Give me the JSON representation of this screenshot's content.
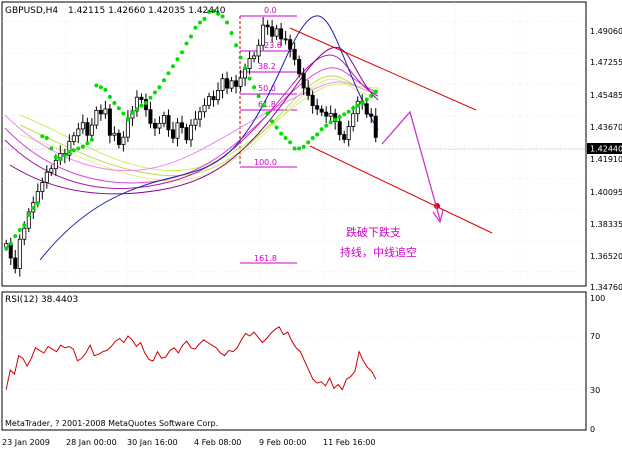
{
  "header": {
    "symbol": "GBPUSD,H4",
    "ohlc": "1.42115 1.42660 1.42035 1.42440"
  },
  "price_axis": {
    "ticks": [
      "1.49060",
      "1.47255",
      "1.45485",
      "1.43670",
      "1.41910",
      "1.40095",
      "1.38335",
      "1.36520",
      "1.34760"
    ],
    "current_price": "1.42440"
  },
  "rsi": {
    "label": "RSI(12) 38.4403",
    "levels": [
      "100",
      "70",
      "30",
      "0"
    ]
  },
  "time_axis": {
    "ticks": [
      "23 Jan 2009",
      "28 Jan 00:00",
      "30 Jan 16:00",
      "4 Feb 08:00",
      "9 Feb 00:00",
      "11 Feb 16:00"
    ]
  },
  "fibonacci": {
    "levels": [
      "0.0",
      "23.6",
      "38.2",
      "50.0",
      "61.8",
      "100.0",
      "161.8"
    ]
  },
  "annotation": {
    "line1": "跌破下跌支",
    "line2": "持线，中线追空"
  },
  "copyright": "MetaTrader, ? 2001-2008 MetaQuotes Software Corp.",
  "colors": {
    "background": "#ffffff",
    "grid": "#c8c8c8",
    "bull_body": "#ffffff",
    "bear_body": "#000000",
    "parabolic_sar": "#00dd00",
    "fib": "#cc00cc",
    "trend_channel": "#dd0000",
    "arrow": "#cc33cc",
    "rsi_line": "#cc0000",
    "annotation_text": "#cc00cc"
  },
  "chart_data": [
    {
      "type": "candlestick",
      "title": "GBPUSD,H4",
      "ohlc_last": {
        "open": 1.42115,
        "high": 1.4266,
        "low": 1.42035,
        "close": 1.4244
      },
      "ylim": [
        1.3395,
        1.5017
      ],
      "closes": [
        1.3637,
        1.3555,
        1.3495,
        1.3662,
        1.3725,
        1.3818,
        1.3872,
        1.3935,
        1.3986,
        1.4045,
        1.4065,
        1.4113,
        1.4152,
        1.4142,
        1.4221,
        1.4253,
        1.4292,
        1.4328,
        1.4256,
        1.4314,
        1.4398,
        1.4378,
        1.4406,
        1.4256,
        1.4267,
        1.4203,
        1.4245,
        1.4354,
        1.4395,
        1.4473,
        1.446,
        1.4402,
        1.4324,
        1.4297,
        1.4324,
        1.4369,
        1.4287,
        1.4239,
        1.4327,
        1.43,
        1.423,
        1.4313,
        1.4348,
        1.439,
        1.4427,
        1.4477,
        1.4459,
        1.4512,
        1.4579,
        1.4525,
        1.4567,
        1.4535,
        1.4583,
        1.4637,
        1.4694,
        1.4709,
        1.477,
        1.4885,
        1.4875,
        1.4822,
        1.4864,
        1.4806,
        1.4802,
        1.4747,
        1.4689,
        1.4607,
        1.4526,
        1.4484,
        1.4425,
        1.4405,
        1.4388,
        1.4365,
        1.438,
        1.4334,
        1.426,
        1.4232,
        1.4306,
        1.4379,
        1.445,
        1.4436,
        1.4377,
        1.4365,
        1.4244
      ],
      "parabolic_sar": [
        1.361,
        1.3637,
        1.368,
        1.3715,
        1.3743,
        1.3801,
        1.384,
        1.3868,
        1.425,
        1.424,
        1.418,
        1.413,
        1.412,
        1.414,
        1.416,
        1.417,
        1.418,
        1.419,
        1.421,
        1.423,
        1.454,
        1.453,
        1.4515,
        1.4475,
        1.444,
        1.441,
        1.438,
        1.4345,
        1.4385,
        1.4405,
        1.4425,
        1.444,
        1.447,
        1.45,
        1.453,
        1.457,
        1.461,
        1.465,
        1.469,
        1.473,
        1.478,
        1.482,
        1.487,
        1.49,
        1.492,
        1.496,
        1.4965,
        1.495,
        1.4935,
        1.49,
        1.484,
        1.477,
        1.47,
        1.464,
        1.458,
        1.453,
        1.448,
        1.4425,
        1.438,
        1.4335,
        1.43,
        1.4265,
        1.424,
        1.4215,
        1.418,
        1.418,
        1.419,
        1.4215,
        1.424,
        1.426,
        1.429,
        1.431,
        1.433,
        1.4345,
        1.436,
        1.4375,
        1.439,
        1.441,
        1.4425,
        1.444,
        1.446,
        1.448,
        1.4505
      ]
    },
    {
      "type": "line",
      "title": "RSI(12) 38.4403",
      "ylim": [
        0,
        100
      ],
      "values": [
        30,
        45,
        42,
        56,
        54,
        48,
        54,
        62,
        60,
        58,
        63,
        61,
        59,
        64,
        62,
        63,
        61,
        52,
        54,
        58,
        64,
        56,
        57,
        59,
        60,
        63,
        67,
        69,
        66,
        71,
        68,
        63,
        66,
        58,
        53,
        52,
        59,
        54,
        55,
        60,
        62,
        58,
        64,
        67,
        62,
        61,
        65,
        68,
        66,
        64,
        62,
        58,
        56,
        60,
        59,
        62,
        68,
        73,
        71,
        74,
        70,
        66,
        69,
        73,
        76,
        78,
        72,
        74,
        67,
        62,
        59,
        52,
        45,
        38,
        35,
        36,
        33,
        39,
        31,
        34,
        30,
        38,
        40,
        44,
        59,
        52,
        47,
        44,
        38
      ]
    }
  ]
}
